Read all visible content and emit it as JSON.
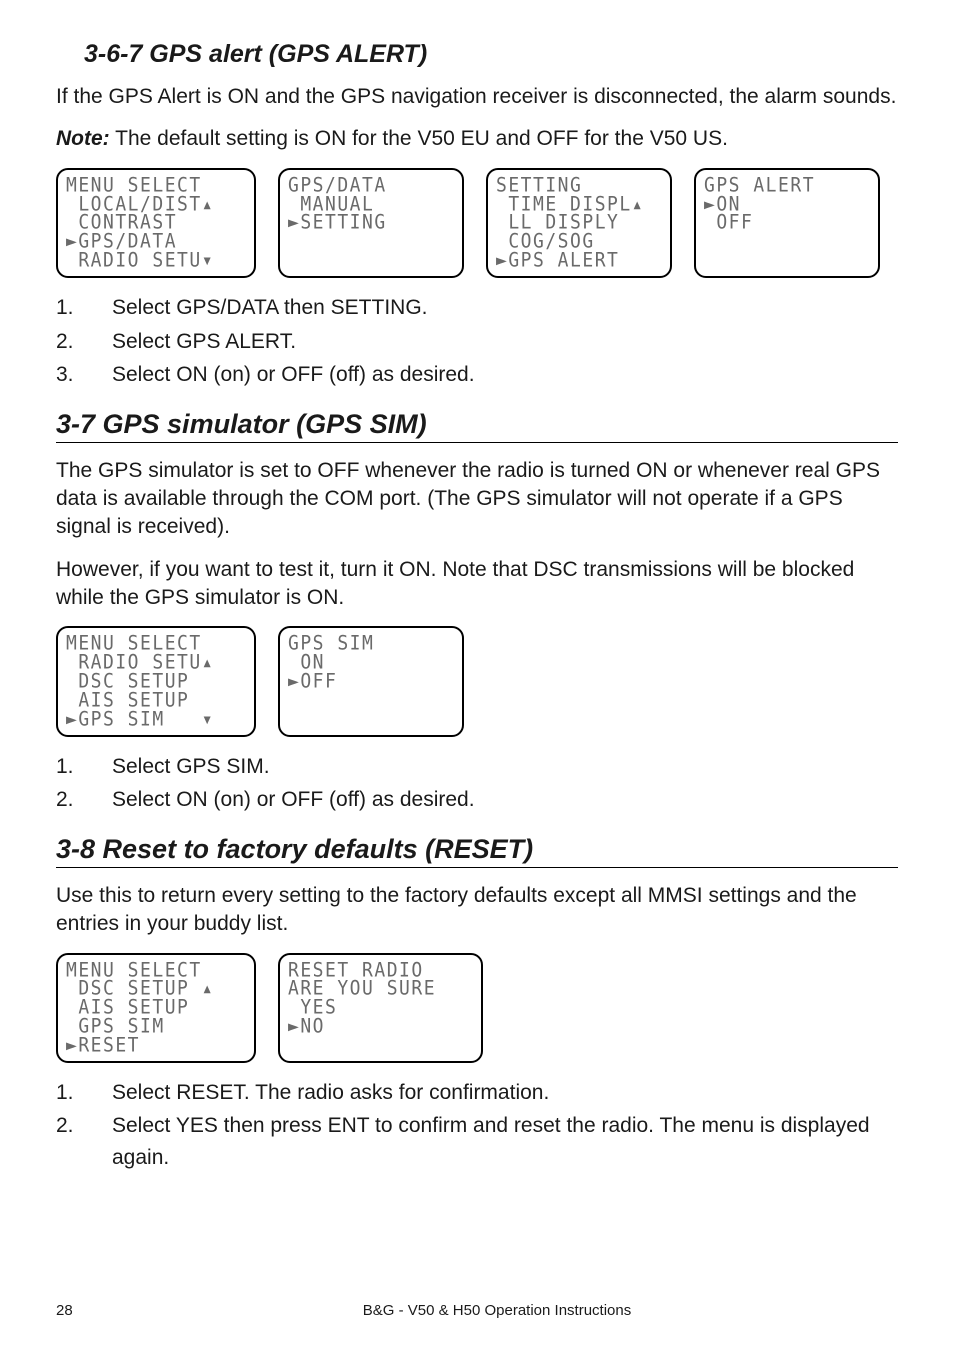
{
  "section_367": {
    "heading": "3-6-7 GPS alert (GPS ALERT)",
    "para": "If the GPS Alert is ON and the GPS navigation receiver is disconnected, the alarm sounds.",
    "note_label": "Note:",
    "note_text": " The default setting is ON for the V50 EU and OFF for the V50 US.",
    "lcds": [
      [
        "MENU SELECT",
        " LOCAL/DIST▴",
        " CONTRAST",
        "►GPS/DATA",
        " RADIO SETU▾"
      ],
      [
        "GPS/DATA",
        " MANUAL",
        "►SETTING"
      ],
      [
        "SETTING",
        " TIME DISPL▴",
        " LL DISPLY",
        " COG/SOG",
        "►GPS ALERT"
      ],
      [
        "GPS ALERT",
        "►ON",
        " OFF"
      ]
    ],
    "steps": [
      "Select GPS/DATA then SETTING.",
      "Select GPS ALERT.",
      "Select ON (on) or OFF (off) as desired."
    ]
  },
  "section_37": {
    "heading": "3-7 GPS simulator (GPS SIM)",
    "para1": "The GPS simulator is set to OFF whenever the radio is turned ON or whenever real GPS data is available through the COM port. (The GPS simulator will not operate if a GPS signal is received).",
    "para2": "However, if you want to test it, turn it ON. Note that DSC transmissions will be blocked while the GPS simulator is ON.",
    "lcds": [
      [
        "MENU SELECT",
        " RADIO SETU▴",
        " DSC SETUP",
        " AIS SETUP",
        "►GPS SIM   ▾"
      ],
      [
        "GPS SIM",
        " ON",
        "►OFF"
      ]
    ],
    "steps": [
      "Select GPS SIM.",
      "Select ON (on) or OFF (off) as desired."
    ]
  },
  "section_38": {
    "heading": "3-8 Reset to factory defaults (RESET)",
    "para": "Use this to return every setting to the factory defaults except all MMSI settings and the entries in your buddy list.",
    "lcds": [
      [
        "MENU SELECT",
        " DSC SETUP ▴",
        " AIS SETUP",
        " GPS SIM",
        "►RESET"
      ],
      [
        "RESET RADIO",
        "ARE YOU SURE",
        " YES",
        "►NO"
      ]
    ],
    "steps": [
      "Select RESET.  The radio asks for confirmation.",
      "Select YES then press ENT to confirm and reset the radio. The menu is displayed again."
    ]
  },
  "footer": {
    "page_number": "28",
    "text": "B&G - V50 & H50 Operation Instructions"
  }
}
